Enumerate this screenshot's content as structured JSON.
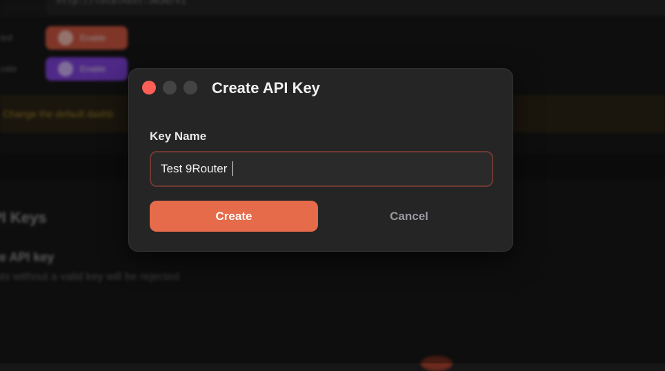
{
  "background": {
    "url_text": "http://localhost:3030/v1",
    "rows": [
      {
        "label": "ted",
        "button_label": "Enable",
        "icon": "cloud-icon"
      },
      {
        "label": "cate",
        "button_label": "Enable",
        "icon": "globe-icon"
      }
    ],
    "banner_text": "Change the default dashb",
    "section_heading": "PI Keys",
    "setting_title": "re API key",
    "setting_description": "sts without a valid key will be rejected"
  },
  "dialog": {
    "title": "Create API Key",
    "field_label": "Key Name",
    "input_value": "Test 9Router",
    "input_placeholder": "",
    "create_label": "Create",
    "cancel_label": "Cancel"
  },
  "colors": {
    "accent": "#e56b4b",
    "close_light": "#ff5f57",
    "dialog_bg": "#252525",
    "input_border": "#6e3a30"
  }
}
